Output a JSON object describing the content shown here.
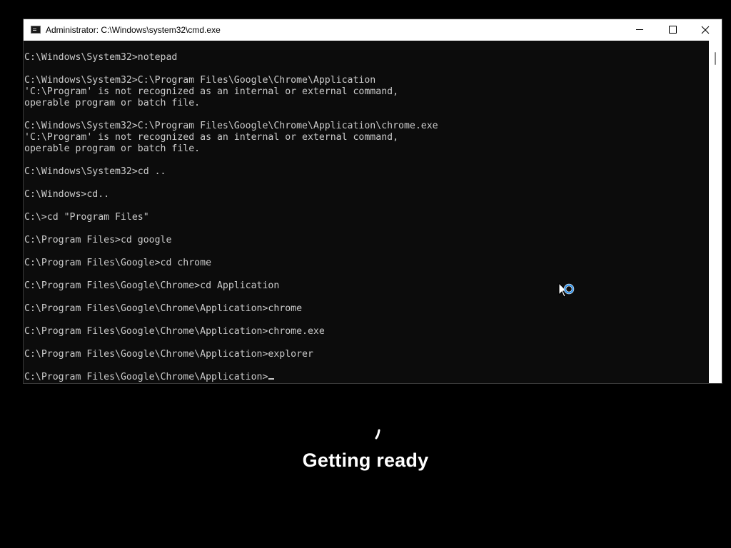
{
  "window": {
    "title": "Administrator: C:\\Windows\\system32\\cmd.exe",
    "app_icon": "cmd-icon",
    "controls": {
      "minimize": "minimize-icon",
      "maximize": "maximize-icon",
      "close": "close-icon"
    }
  },
  "console": {
    "lines": [
      "C:\\Windows\\System32>notepad",
      "",
      "C:\\Windows\\System32>C:\\Program Files\\Google\\Chrome\\Application",
      "'C:\\Program' is not recognized as an internal or external command,",
      "operable program or batch file.",
      "",
      "C:\\Windows\\System32>C:\\Program Files\\Google\\Chrome\\Application\\chrome.exe",
      "'C:\\Program' is not recognized as an internal or external command,",
      "operable program or batch file.",
      "",
      "C:\\Windows\\System32>cd ..",
      "",
      "C:\\Windows>cd..",
      "",
      "C:\\>cd \"Program Files\"",
      "",
      "C:\\Program Files>cd google",
      "",
      "C:\\Program Files\\Google>cd chrome",
      "",
      "C:\\Program Files\\Google\\Chrome>cd Application",
      "",
      "C:\\Program Files\\Google\\Chrome\\Application>chrome",
      "",
      "C:\\Program Files\\Google\\Chrome\\Application>chrome.exe",
      "",
      "C:\\Program Files\\Google\\Chrome\\Application>explorer",
      ""
    ],
    "prompt": "C:\\Program Files\\Google\\Chrome\\Application>"
  },
  "overlay": {
    "status_text": "Getting ready",
    "spinner_icon": "loading-spinner-icon",
    "cursor_icon": "busy-cursor-icon"
  },
  "colors": {
    "desktop_background": "#000000",
    "console_background": "#0c0c0c",
    "console_text": "#cccccc",
    "title_bar": "#ffffff",
    "busy_ring": "#2f8fe6",
    "status_text": "#ffffff"
  }
}
